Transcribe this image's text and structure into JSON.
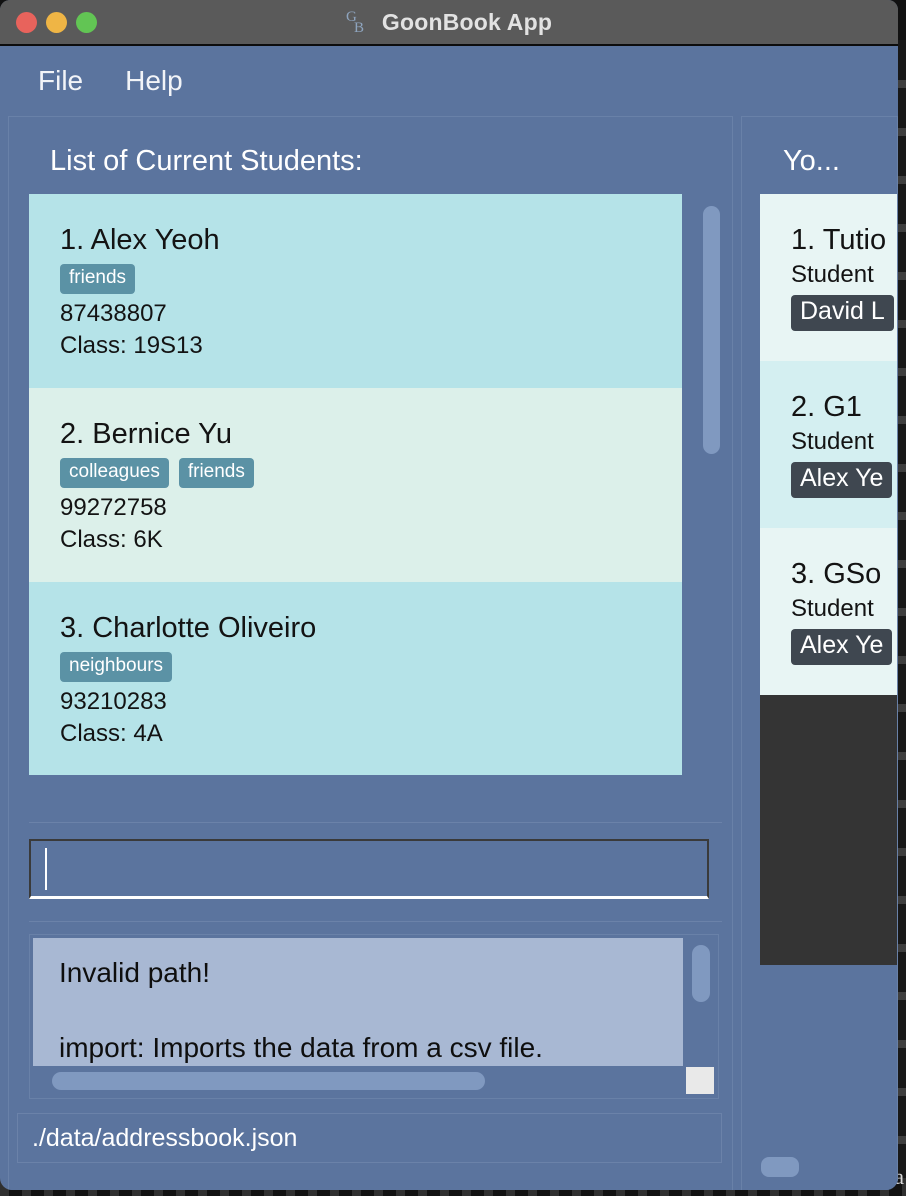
{
  "titlebar": {
    "app_title": "GoonBook App",
    "logo_text": "GB",
    "traffic_lights": [
      "close",
      "minimize",
      "zoom"
    ]
  },
  "menubar": {
    "items": [
      {
        "label": "File"
      },
      {
        "label": "Help"
      }
    ]
  },
  "persons_panel": {
    "header": "List of Current Students:",
    "cards": [
      {
        "name": "1. Alex Yeoh",
        "tags": [
          "friends"
        ],
        "phone": "87438807",
        "class": "Class: 19S13"
      },
      {
        "name": "2. Bernice Yu",
        "tags": [
          "colleagues",
          "friends"
        ],
        "phone": "99272758",
        "class": "Class: 6K"
      },
      {
        "name": "3. Charlotte Oliveiro",
        "tags": [
          "neighbours"
        ],
        "phone": "93210283",
        "class": "Class: 4A"
      }
    ]
  },
  "command_box": {
    "value": "",
    "placeholder": ""
  },
  "result_display": {
    "lines": [
      "Invalid path!",
      "",
      "import: Imports the data from a csv file."
    ]
  },
  "status_bar": {
    "file_path": "./data/addressbook.json"
  },
  "groups_panel": {
    "header": "Yo...",
    "cards": [
      {
        "name": "1. Tutio",
        "sub": "Student",
        "tag": "David L"
      },
      {
        "name": "2. G1",
        "sub": "Student",
        "tag": "Alex Ye"
      },
      {
        "name": "3. GSo",
        "sub": "Student",
        "tag": "Alex Ye"
      }
    ]
  },
  "desktop": {
    "corner_glyph": "a"
  },
  "colors": {
    "window_background": "#5b749e",
    "titlebar": "#5a5a5a",
    "card_odd": "#b5e3e8",
    "card_even": "#dcf0ea",
    "tag_background": "#5b92a5",
    "group_tag_background": "#3f4750",
    "result_background": "#a8b8d3",
    "scrollbar_thumb": "#8099c0",
    "dark_block": "#343434"
  }
}
